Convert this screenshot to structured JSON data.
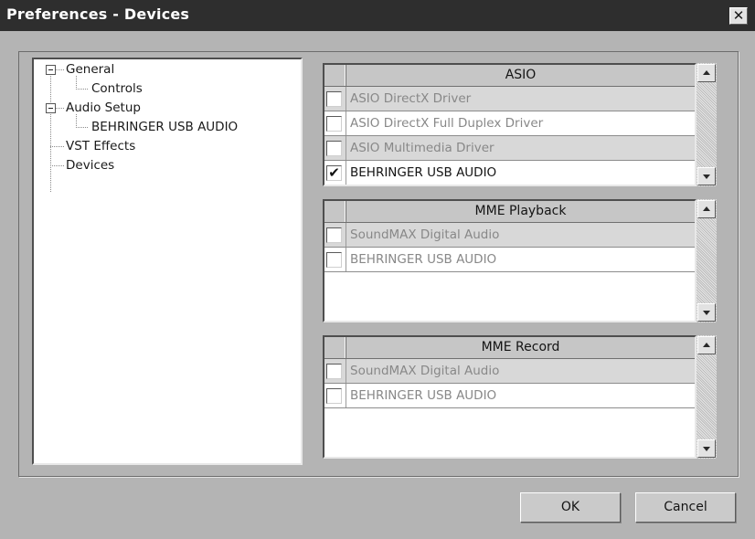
{
  "window": {
    "title": "Preferences - Devices",
    "close_glyph": "✕"
  },
  "tree": {
    "items": [
      {
        "label": "General",
        "expanded": true
      },
      {
        "label": "Controls"
      },
      {
        "label": "Audio Setup",
        "expanded": true
      },
      {
        "label": "BEHRINGER USB AUDIO"
      },
      {
        "label": "VST Effects"
      },
      {
        "label": "Devices"
      }
    ]
  },
  "asio": {
    "header": "ASIO",
    "rows": [
      {
        "label": "ASIO DirectX Driver",
        "checked": false
      },
      {
        "label": "ASIO DirectX Full Duplex Driver",
        "checked": false
      },
      {
        "label": "ASIO Multimedia Driver",
        "checked": false
      },
      {
        "label": "BEHRINGER USB AUDIO",
        "checked": true,
        "check_glyph": "✔"
      }
    ]
  },
  "mme_playback": {
    "header": "MME Playback",
    "rows": [
      {
        "label": "SoundMAX Digital Audio",
        "checked": false
      },
      {
        "label": "BEHRINGER USB AUDIO",
        "checked": false
      }
    ]
  },
  "mme_record": {
    "header": "MME Record",
    "rows": [
      {
        "label": "SoundMAX Digital Audio",
        "checked": false
      },
      {
        "label": "BEHRINGER USB AUDIO",
        "checked": false
      }
    ]
  },
  "buttons": {
    "ok": "OK",
    "cancel": "Cancel"
  },
  "icons": {
    "close": "close-icon",
    "expander": "tree-expander-minus-icon",
    "scroll_up": "scroll-up-arrow-icon",
    "scroll_down": "scroll-down-arrow-icon",
    "checkmark": "checkmark-icon"
  }
}
